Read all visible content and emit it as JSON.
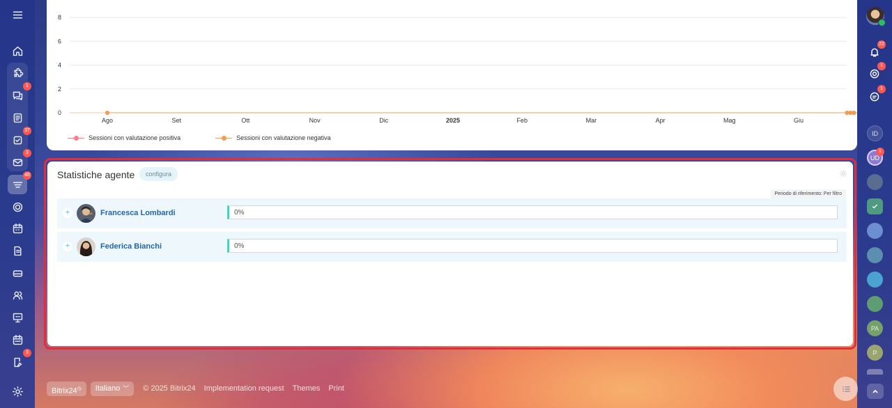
{
  "chart_data": {
    "type": "line",
    "categories": [
      "Ago",
      "Set",
      "Ott",
      "Nov",
      "Dic",
      "2025",
      "Feb",
      "Mar",
      "Apr",
      "Mag",
      "Giu"
    ],
    "y_ticks": [
      "8",
      "6",
      "4",
      "2",
      "0"
    ],
    "ylim": [
      0,
      8
    ],
    "grid": true,
    "legend_placement": "bottom-left",
    "series": [
      {
        "name": "Sessioni con valutazione positiva",
        "color": "#ff7a8a",
        "x": [
          0,
          10.7,
          10.75,
          10.8,
          11.3
        ],
        "values": [
          0,
          0,
          0,
          0,
          0
        ]
      },
      {
        "name": "Sessioni con valutazione negativa",
        "color": "#f39c51",
        "x": [
          0,
          10.7,
          10.75,
          10.8,
          11.3
        ],
        "values": [
          0,
          0,
          0,
          0,
          0
        ]
      }
    ]
  },
  "agent_stats": {
    "title": "Statistiche agente",
    "configure_label": "configura",
    "period_label": "Periodo di riferimento: Per filtro",
    "agents": [
      {
        "name": "Francesca Lombardi",
        "percent_label": "0%",
        "fraction": 0
      },
      {
        "name": "Federica Bianchi",
        "percent_label": "0%",
        "fraction": 0
      }
    ]
  },
  "footer": {
    "brand": "Bitrix24",
    "language": "Italiano",
    "copyright": "© 2025 Bitrix24",
    "links": [
      "Implementation request",
      "Themes",
      "Print"
    ]
  },
  "left_nav": {
    "badges": {
      "chat": "1",
      "tasks": "37",
      "mail": "3",
      "crm": "48",
      "approvals": "3"
    }
  },
  "right_nav": {
    "badges": {
      "notifications": "22",
      "copilot": "1",
      "support": "1",
      "ud": "1"
    },
    "avatars": [
      "ID",
      "UD",
      "PA",
      "P"
    ]
  },
  "colors": {
    "accent": "#2fc6f6",
    "highlight": "#e02f3a",
    "bar": "#3fd6c4",
    "link": "#2066b0"
  }
}
